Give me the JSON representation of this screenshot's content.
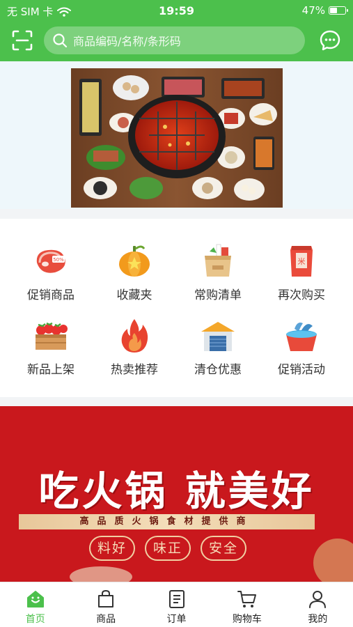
{
  "status_bar": {
    "carrier": "无 SIM 卡",
    "time": "19:59",
    "battery": "47%",
    "battery_level": 0.47
  },
  "search": {
    "placeholder": "商品编码/名称/条形码"
  },
  "categories": [
    {
      "label": "促销商品",
      "icon": "meat-sale-icon"
    },
    {
      "label": "收藏夹",
      "icon": "pumpkin-star-icon"
    },
    {
      "label": "常购清单",
      "icon": "grocery-bag-icon"
    },
    {
      "label": "再次购买",
      "icon": "rice-bag-icon"
    },
    {
      "label": "新品上架",
      "icon": "strawberry-crate-icon"
    },
    {
      "label": "热卖推荐",
      "icon": "fire-icon"
    },
    {
      "label": "清仓优惠",
      "icon": "warehouse-icon"
    },
    {
      "label": "促销活动",
      "icon": "fish-bucket-icon"
    }
  ],
  "promo_banner": {
    "title": "吃火锅 就美好",
    "subtitle": "高品质火锅食材提供商",
    "badges": [
      "料好",
      "味正",
      "安全"
    ]
  },
  "tabbar": {
    "items": [
      {
        "label": "首页",
        "icon": "home-icon",
        "active": true
      },
      {
        "label": "商品",
        "icon": "bag-icon",
        "active": false
      },
      {
        "label": "订单",
        "icon": "order-icon",
        "active": false
      },
      {
        "label": "购物车",
        "icon": "cart-icon",
        "active": false
      },
      {
        "label": "我的",
        "icon": "user-icon",
        "active": false
      }
    ]
  },
  "colors": {
    "brand_green": "#4cc04c",
    "banner_red": "#c9181d"
  }
}
